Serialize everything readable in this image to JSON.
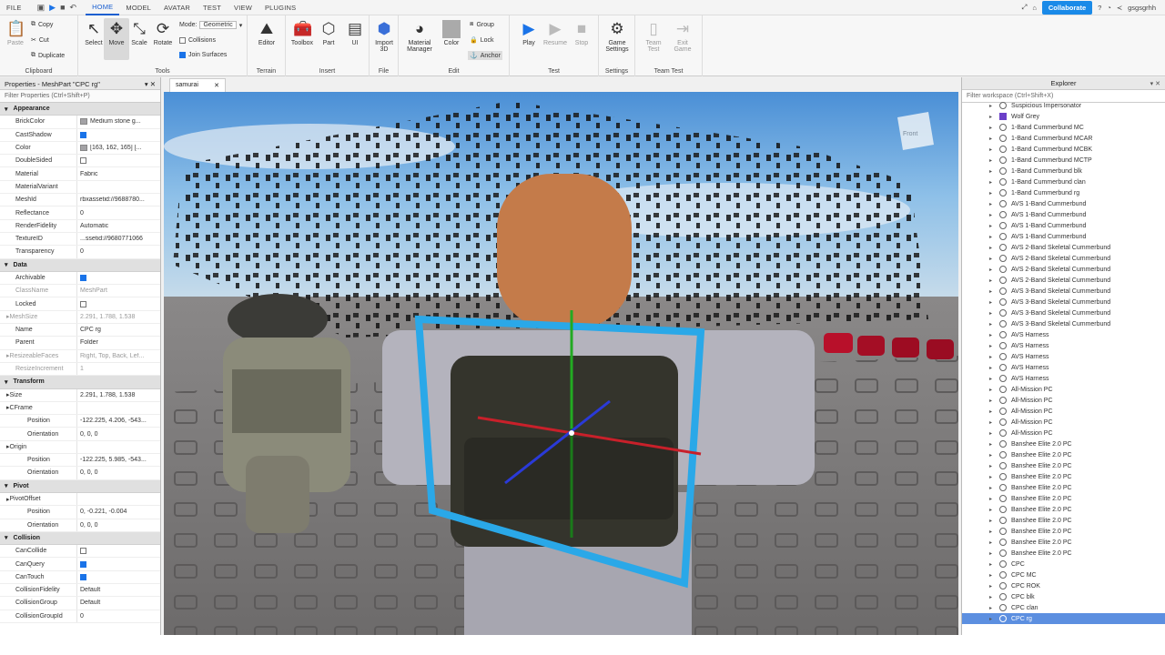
{
  "menubar": {
    "items": [
      "FILE",
      "HOME",
      "MODEL",
      "AVATAR",
      "TEST",
      "VIEW",
      "PLUGINS"
    ],
    "active": "HOME",
    "collaborate": "Collaborate",
    "username": "gsgsgrhh"
  },
  "ribbon": {
    "clipboard": {
      "label": "Clipboard",
      "paste": "Paste",
      "copy": "Copy",
      "cut": "Cut",
      "duplicate": "Duplicate"
    },
    "tools": {
      "label": "Tools",
      "select": "Select",
      "move": "Move",
      "scale": "Scale",
      "rotate": "Rotate",
      "mode_label": "Mode:",
      "mode_value": "Geometric",
      "collisions": "Collisions",
      "join_surfaces": "Join Surfaces"
    },
    "terrain": {
      "label": "Terrain",
      "editor": "Editor"
    },
    "insert": {
      "label": "Insert",
      "toolbox": "Toolbox",
      "part": "Part",
      "ui": "UI"
    },
    "file": {
      "label": "File",
      "import3d": "Import 3D"
    },
    "edit": {
      "label": "Edit",
      "material_manager": "Material Manager",
      "color": "Color",
      "group": "Group",
      "lock": "Lock",
      "anchor": "Anchor"
    },
    "test": {
      "label": "Test",
      "play": "Play",
      "resume": "Resume",
      "stop": "Stop"
    },
    "settings": {
      "label": "Settings",
      "game_settings": "Game Settings"
    },
    "team_test": {
      "label": "Team Test",
      "team_test": "Team Test",
      "exit_game": "Exit Game"
    }
  },
  "properties": {
    "title": "Properties - MeshPart \"CPC rg\"",
    "filter_placeholder": "Filter Properties (Ctrl+Shift+P)",
    "sections": [
      {
        "name": "Appearance",
        "rows": [
          {
            "n": "BrickColor",
            "v": "Medium stone g...",
            "swatch": "#a3a2a5"
          },
          {
            "n": "CastShadow",
            "v": "",
            "check": true
          },
          {
            "n": "Color",
            "v": "[163, 162, 165] [...",
            "swatch": "#a3a2a5"
          },
          {
            "n": "DoubleSided",
            "v": "",
            "check": false
          },
          {
            "n": "Material",
            "v": "Fabric"
          },
          {
            "n": "MaterialVariant",
            "v": ""
          },
          {
            "n": "MeshId",
            "v": "rbxassetid://9688780..."
          },
          {
            "n": "Reflectance",
            "v": "0"
          },
          {
            "n": "RenderFidelity",
            "v": "Automatic"
          },
          {
            "n": "TextureID",
            "v": "...ssetid://9680771066"
          },
          {
            "n": "Transparency",
            "v": "0"
          }
        ]
      },
      {
        "name": "Data",
        "rows": [
          {
            "n": "Archivable",
            "v": "",
            "check": true
          },
          {
            "n": "ClassName",
            "v": "MeshPart",
            "grey": true
          },
          {
            "n": "Locked",
            "v": "",
            "check": false
          },
          {
            "n": "MeshSize",
            "v": "2.291, 1.788, 1.538",
            "grey": true,
            "exp": true
          },
          {
            "n": "Name",
            "v": "CPC rg"
          },
          {
            "n": "Parent",
            "v": "Folder"
          },
          {
            "n": "ResizeableFaces",
            "v": "Right, Top, Back, Lef...",
            "grey": true,
            "exp": true
          },
          {
            "n": "ResizeIncrement",
            "v": "1",
            "grey": true
          }
        ]
      },
      {
        "name": "Transform",
        "rows": [
          {
            "n": "Size",
            "v": "2.291, 1.788, 1.538",
            "exp": true
          },
          {
            "n": "CFrame",
            "v": "",
            "exp": true
          },
          {
            "n": "Position",
            "v": "-122.225, 4.206, -543...",
            "sub": true
          },
          {
            "n": "Orientation",
            "v": "0, 0, 0",
            "sub": true
          },
          {
            "n": "Origin",
            "v": "",
            "exp": true
          },
          {
            "n": "Position",
            "v": "-122.225, 5.985, -543...",
            "sub": true
          },
          {
            "n": "Orientation",
            "v": "0, 0, 0",
            "sub": true
          }
        ]
      },
      {
        "name": "Pivot",
        "rows": [
          {
            "n": "PivotOffset",
            "v": "",
            "exp": true
          },
          {
            "n": "Position",
            "v": "0, -0.221, -0.004",
            "sub": true
          },
          {
            "n": "Orientation",
            "v": "0, 0, 0",
            "sub": true
          }
        ]
      },
      {
        "name": "Collision",
        "rows": [
          {
            "n": "CanCollide",
            "v": "",
            "check": false
          },
          {
            "n": "CanQuery",
            "v": "",
            "check": true
          },
          {
            "n": "CanTouch",
            "v": "",
            "check": true
          },
          {
            "n": "CollisionFidelity",
            "v": "Default"
          },
          {
            "n": "CollisionGroup",
            "v": "Default"
          },
          {
            "n": "CollisionGroupId",
            "v": "0"
          }
        ]
      }
    ]
  },
  "viewport": {
    "tab": "samurai",
    "view_cube_label": "Front"
  },
  "explorer": {
    "title": "Explorer",
    "filter_placeholder": "Filter workspace (Ctrl+Shift+X)",
    "items": [
      "Suspicious Impersonator",
      "Wolf Grey",
      "1-Band Cummerbund MC",
      "1-Band Cummerbund MCAR",
      "1-Band Cummerbund MCBK",
      "1-Band Cummerbund MCTP",
      "1-Band Cummerbund blk",
      "1-Band Cummerbund clan",
      "1-Band Cummerbund rg",
      "AVS 1-Band Cummerbund",
      "AVS 1-Band Cummerbund",
      "AVS 1-Band Cummerbund",
      "AVS 1-Band Cummerbund",
      "AVS 2-Band Skeletal Cummerbund",
      "AVS 2-Band Skeletal Cummerbund",
      "AVS 2-Band Skeletal Cummerbund",
      "AVS 2-Band Skeletal Cummerbund",
      "AVS 3-Band Skeletal Cummerbund",
      "AVS 3-Band Skeletal Cummerbund",
      "AVS 3-Band Skeletal Cummerbund",
      "AVS 3-Band Skeletal Cummerbund",
      "AVS Harness",
      "AVS Harness",
      "AVS Harness",
      "AVS Harness",
      "AVS Harness",
      "All-Mission PC",
      "All-Mission PC",
      "All-Mission PC",
      "All-Mission PC",
      "All-Mission PC",
      "Banshee Elite 2.0 PC",
      "Banshee Elite 2.0 PC",
      "Banshee Elite 2.0 PC",
      "Banshee Elite 2.0 PC",
      "Banshee Elite 2.0 PC",
      "Banshee Elite 2.0 PC",
      "Banshee Elite 2.0 PC",
      "Banshee Elite 2.0 PC",
      "Banshee Elite 2.0 PC",
      "Banshee Elite 2.0 PC",
      "Banshee Elite 2.0 PC",
      "CPC",
      "CPC MC",
      "CPC ROK",
      "CPC blk",
      "CPC clan",
      "CPC rg"
    ],
    "selected_index": 47
  },
  "colors": {
    "accent": "#1a73e8",
    "selection": "#5c8fe0",
    "select_box": "#2aa8e8"
  }
}
